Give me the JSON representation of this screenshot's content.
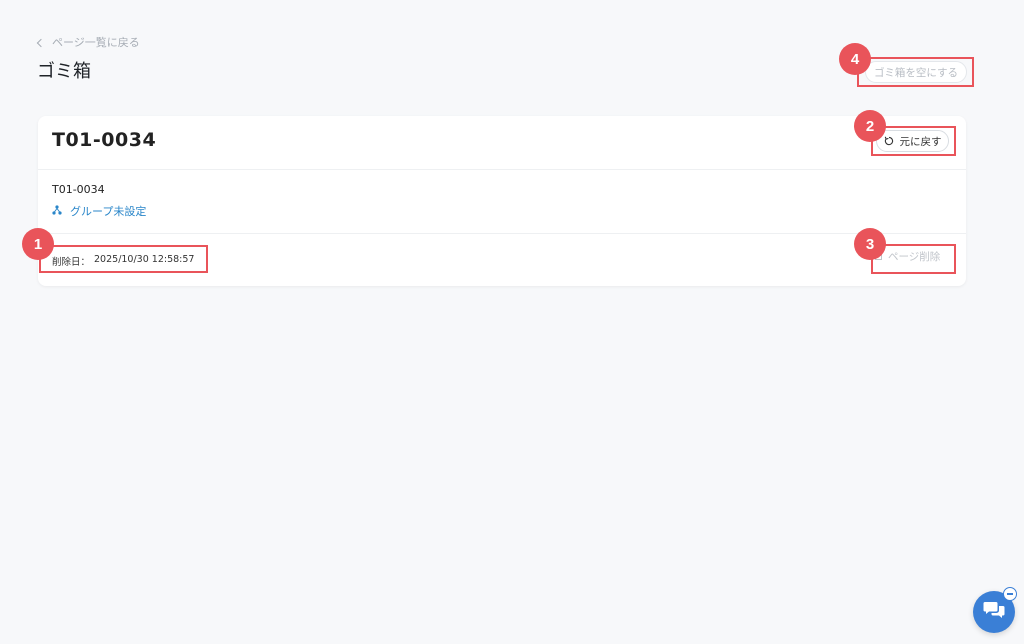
{
  "header": {
    "back_label": "ページ一覧に戻る",
    "title": "ゴミ箱",
    "empty_trash_label": "ゴミ箱を空にする"
  },
  "card": {
    "title": "T01-0034",
    "subtitle": "T01-0034",
    "group_label": "グループ未設定",
    "restore_label": "元に戻す",
    "deleted_label": "削除日：",
    "deleted_value": "2025/10/30 12:58:57",
    "delete_page_label": "ページ削除"
  },
  "annotations": [
    "1",
    "2",
    "3",
    "4"
  ],
  "colors": {
    "accent": "#e9545a",
    "link": "#2a86c9",
    "chat": "#3a7fd6",
    "background": "#f7f8fa"
  }
}
